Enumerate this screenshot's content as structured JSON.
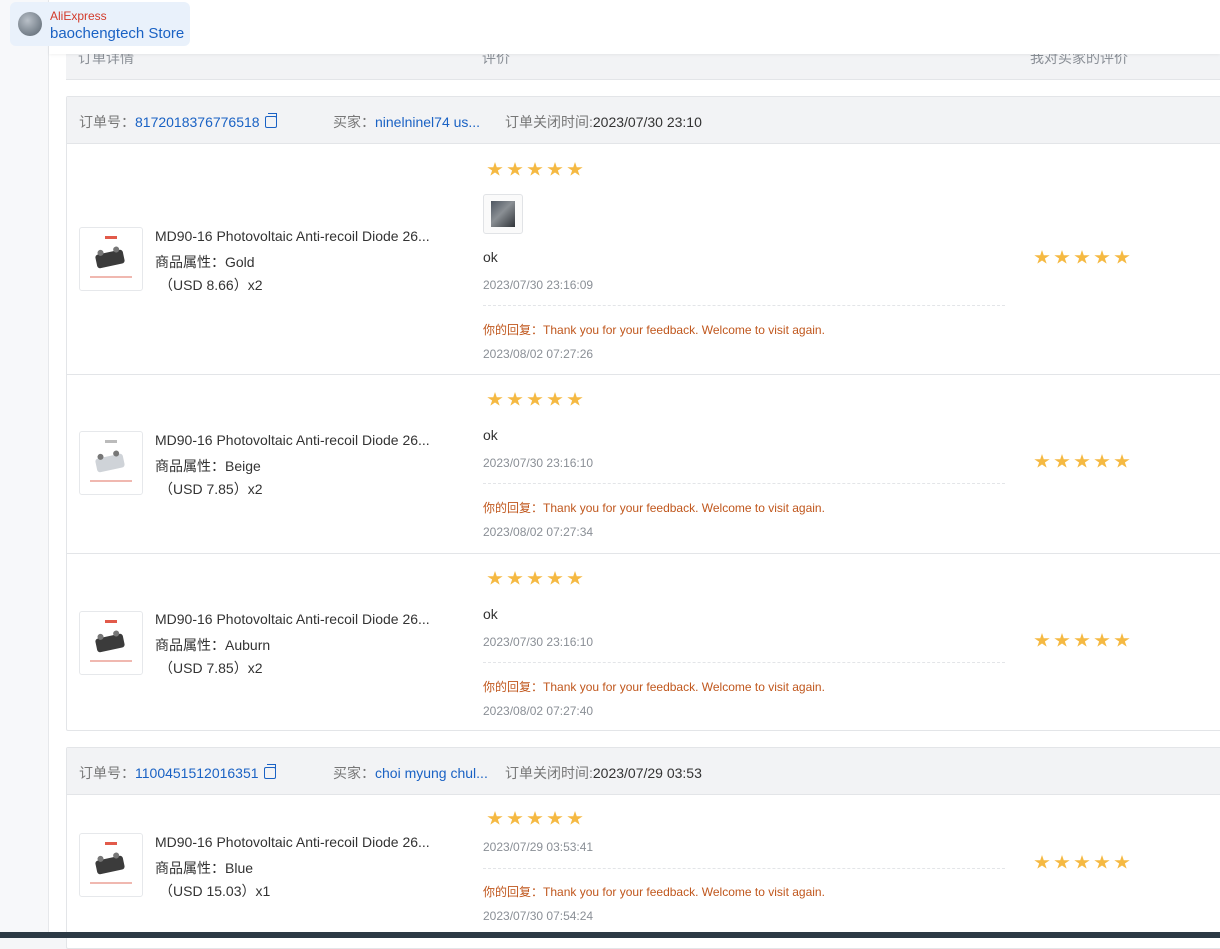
{
  "store_badge": {
    "brand": "AliExpress",
    "store_name": "baochengtech Store"
  },
  "columns": [
    "订单详情",
    "评价",
    "我对买家的评价"
  ],
  "labels": {
    "order_no": "订单号：",
    "buyer": "买家：",
    "close_time": "订单关闭时间:",
    "attr": "商品属性：",
    "reply": "你的回复："
  },
  "orders": [
    {
      "order_no": "8172018376776518",
      "buyer": "ninelninel74 us...",
      "close_time": "2023/07/30 23:10",
      "items": [
        {
          "name": "MD90-16 Photovoltaic Anti-recoil Diode 26...",
          "attr": "Gold",
          "price": "（USD  8.66）x2",
          "rating": 5,
          "review_text": "ok",
          "review_time": "2023/07/30 23:16:09",
          "reply_text": "Thank you for your feedback. Welcome to visit again.",
          "reply_time": "2023/08/02 07:27:26",
          "my_rating": 5
        },
        {
          "name": "MD90-16 Photovoltaic Anti-recoil Diode 26...",
          "attr": "Beige",
          "price": "（USD  7.85）x2",
          "rating": 5,
          "review_text": "ok",
          "review_time": "2023/07/30 23:16:10",
          "reply_text": "Thank you for your feedback. Welcome to visit again.",
          "reply_time": "2023/08/02 07:27:34",
          "my_rating": 5
        },
        {
          "name": "MD90-16 Photovoltaic Anti-recoil Diode 26...",
          "attr": "Auburn",
          "price": "（USD  7.85）x2",
          "rating": 5,
          "review_text": "ok",
          "review_time": "2023/07/30 23:16:10",
          "reply_text": "Thank you for your feedback. Welcome to visit again.",
          "reply_time": "2023/08/02 07:27:40",
          "my_rating": 5
        }
      ]
    },
    {
      "order_no": "1100451512016351",
      "buyer": "choi myung chul...",
      "close_time": "2023/07/29 03:53",
      "items": [
        {
          "name": "MD90-16 Photovoltaic Anti-recoil Diode 26...",
          "attr": "Blue",
          "price": "（USD  15.03）x1",
          "rating": 5,
          "review_time": "2023/07/29 03:53:41",
          "reply_text": "Thank you for your feedback. Welcome to visit again.",
          "reply_time": "2023/07/30 07:54:24",
          "my_rating": 5
        }
      ]
    }
  ],
  "colors": {
    "link": "#1a62c4",
    "star": "#f5b942",
    "reply": "#c0571d",
    "brand": "#d23b2b"
  }
}
